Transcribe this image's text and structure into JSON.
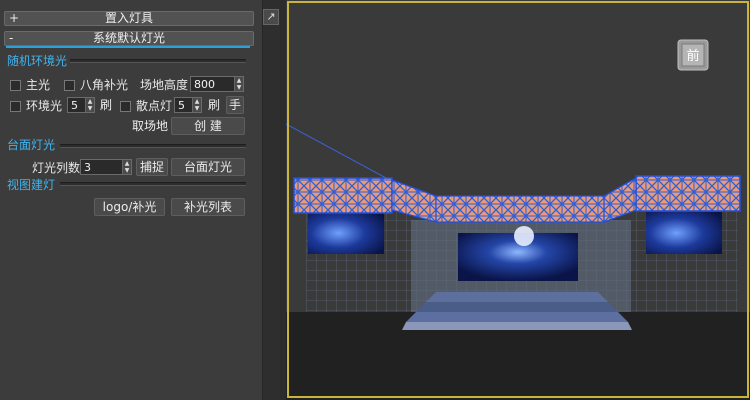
{
  "panel": {
    "pin_icon": "↗",
    "insert_rollout": {
      "sign": "+",
      "title": "置入灯具"
    },
    "system_rollout": {
      "sign": "-",
      "title": "系统默认灯光"
    },
    "random_ambient": {
      "title": "随机环境光",
      "main_light": "主光",
      "octagon_fill": "八角补光",
      "field_height_label": "场地高度",
      "field_height_value": "800",
      "ambient_light": "环境光",
      "ambient_count": "5",
      "brush_1": "刷",
      "scatter_light": "散点灯",
      "scatter_count": "5",
      "brush_2": "刷",
      "hand": "手",
      "pick_field": "取场地",
      "create": "创 建"
    },
    "stage_lights": {
      "title": "台面灯光",
      "columns_label": "灯光列数",
      "columns_value": "3",
      "capture": "捕捉",
      "stage_light_button": "台面灯光"
    },
    "view_lights": {
      "title": "视图建灯",
      "logo_fill": "logo/补光",
      "fill_list": "补光列表"
    }
  },
  "viewport": {
    "border_color": "#c8b53a",
    "nav_icon": "viewcube-icon",
    "nav_label": "前"
  }
}
